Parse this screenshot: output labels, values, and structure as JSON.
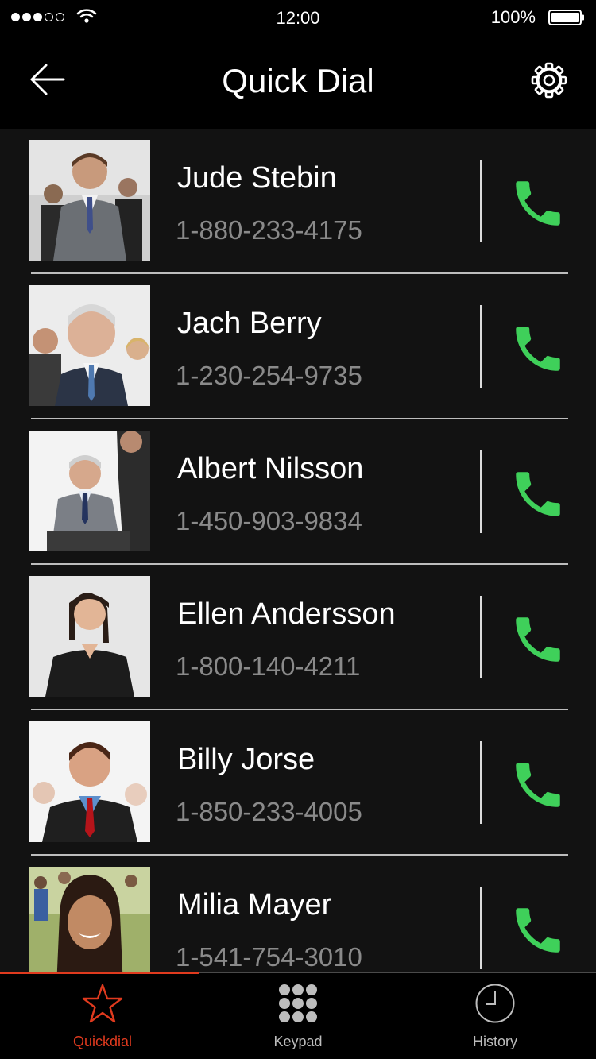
{
  "status": {
    "time": "12:00",
    "battery": "100%"
  },
  "nav": {
    "title": "Quick Dial"
  },
  "contacts": [
    {
      "name": "Jude Stebin",
      "phone": "1-880-233-4175"
    },
    {
      "name": "Jach Berry",
      "phone": "1-230-254-9735"
    },
    {
      "name": "Albert Nilsson",
      "phone": "1-450-903-9834"
    },
    {
      "name": "Ellen Andersson",
      "phone": "1-800-140-4211"
    },
    {
      "name": "Billy Jorse",
      "phone": "1-850-233-4005"
    },
    {
      "name": "Milia Mayer",
      "phone": "1-541-754-3010"
    }
  ],
  "tabs": [
    {
      "label": "Quickdial",
      "icon": "star-icon",
      "active": true
    },
    {
      "label": "Keypad",
      "icon": "keypad-icon",
      "active": false
    },
    {
      "label": "History",
      "icon": "clock-icon",
      "active": false
    }
  ],
  "colors": {
    "accent": "#e03a1e",
    "call": "#3fd05a",
    "background": "#121212"
  }
}
